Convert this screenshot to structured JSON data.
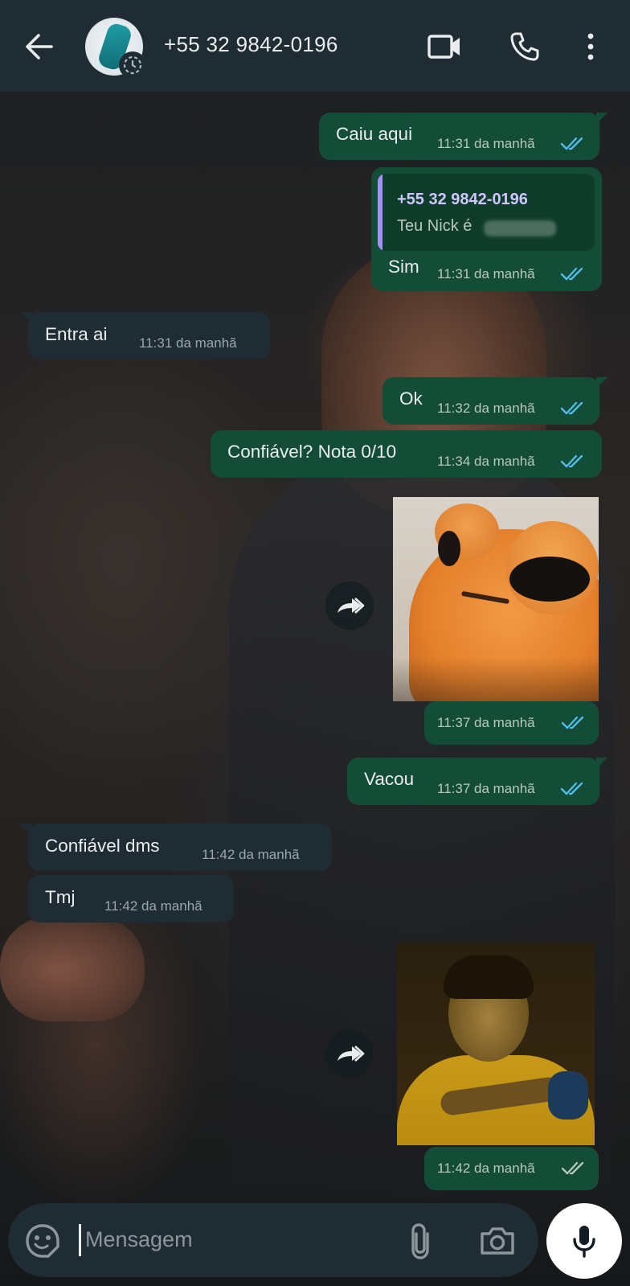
{
  "header": {
    "contact_name": "+55 32 9842-0196",
    "icons": [
      "back-arrow-icon",
      "avatar",
      "status-timer-icon",
      "video-call-icon",
      "phone-icon",
      "more-vert-icon"
    ]
  },
  "messages": [
    {
      "dir": "out",
      "text": "Caiu aqui",
      "time": "11:31 da manhã",
      "ticks": "read"
    },
    {
      "dir": "out",
      "quote": {
        "name": "+55 32 9842-0196",
        "text": "Teu Nick é"
      },
      "text": "Sim",
      "time": "11:31 da manhã",
      "ticks": "read"
    },
    {
      "dir": "in",
      "text": "Entra ai",
      "time": "11:31 da manhã"
    },
    {
      "dir": "out",
      "text": "Ok",
      "time": "11:32 da manhã",
      "ticks": "read"
    },
    {
      "dir": "out",
      "text": "Confiável? Nota 0/10",
      "time": "11:34 da manhã",
      "ticks": "read"
    },
    {
      "dir": "out",
      "type": "image",
      "image": "orange-character-image",
      "time": "11:37 da manhã",
      "ticks": "read"
    },
    {
      "dir": "out",
      "text": "Vacou",
      "time": "11:37 da manhã",
      "ticks": "read"
    },
    {
      "dir": "in",
      "text": "Confiável dms",
      "time": "11:42 da manhã"
    },
    {
      "dir": "in",
      "text": "Tmj",
      "time": "11:42 da manhã"
    },
    {
      "dir": "out",
      "type": "image",
      "image": "football-player-image",
      "time": "11:42 da manhã",
      "ticks": "delivered"
    }
  ],
  "composer": {
    "placeholder": "Mensagem",
    "icons": [
      "emoji-icon",
      "attach-icon",
      "camera-icon",
      "mic-icon"
    ]
  },
  "colors": {
    "header_bg": "#1f2c33",
    "outgoing_bubble": "#144d37",
    "incoming_bubble": "#1f2c33",
    "read_ticks": "#53bdeb",
    "quote_accent": "#a791f7"
  }
}
